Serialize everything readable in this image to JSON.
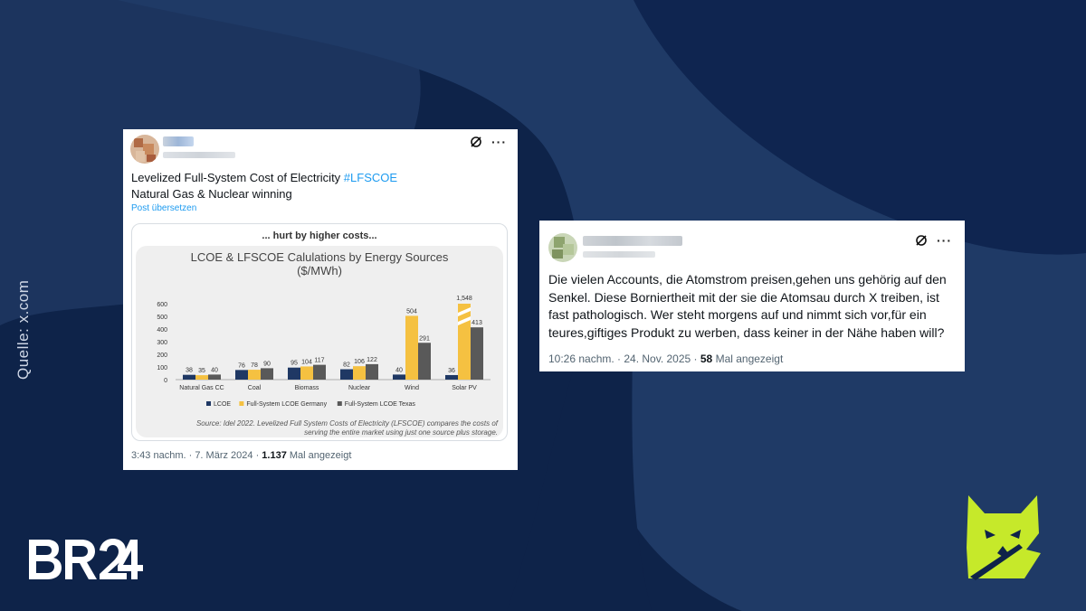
{
  "source_label": "Quelle: x.com",
  "brand_logo_text": "BR24",
  "icons": {
    "grok": "grok-slash-icon",
    "more": "more-dots-icon",
    "fox": "fox-logo"
  },
  "colors": {
    "background": "#0e2349",
    "hashtag": "#1d9bf0",
    "fox": "#c6e92a",
    "bar_lcoe": "#1f3864",
    "bar_germany": "#f5c141",
    "bar_texas": "#595959"
  },
  "tweet1": {
    "text_line1": "Levelized Full-System Cost of Electricity ",
    "hashtag": "#LFSCOE",
    "text_line2": "Natural Gas & Nuclear winning",
    "translate": "Post übersetzen",
    "media_header": "... hurt by higher costs...",
    "chart_title_line1": "LCOE & LFSCOE Calulations by Energy Sources",
    "chart_title_line2": "($/MWh)",
    "chart_source": "Source: Idel 2022. Levelized Full System Costs of Electricity (LFSCOE) compares the costs of serving the entire market using just one source plus storage.",
    "time": "3:43 nachm. · 7. März 2024 · ",
    "views_count": "1.137",
    "views_label": " Mal angezeigt"
  },
  "tweet2": {
    "text": "Die vielen Accounts, die Atomstrom preisen,gehen uns gehörig auf den Senkel. Diese Borniertheit mit der sie die Atomsau durch X treiben, ist fast  pathologisch. Wer steht morgens auf und nimmt sich vor,für ein teures,giftiges Produkt zu werben, dass keiner in der Nähe haben will?",
    "time": "10:26 nachm. · 24. Nov. 2025 · ",
    "views_count": "58",
    "views_label": " Mal angezeigt"
  },
  "chart_data": {
    "type": "bar",
    "title": "LCOE & LFSCOE Calulations by Energy Sources ($/MWh)",
    "categories": [
      "Natural Gas CC",
      "Coal",
      "Biomass",
      "Nuclear",
      "Wind",
      "Solar PV"
    ],
    "series": [
      {
        "name": "LCOE",
        "values": [
          38,
          76,
          95,
          82,
          40,
          36
        ]
      },
      {
        "name": "Full-System LCOE Germany",
        "values": [
          35,
          78,
          104,
          106,
          504,
          1548
        ]
      },
      {
        "name": "Full-System LCOE Texas",
        "values": [
          40,
          90,
          117,
          122,
          291,
          413
        ]
      }
    ],
    "yticks": [
      0,
      100,
      200,
      300,
      400,
      500,
      600
    ],
    "ylim": [
      0,
      600
    ],
    "legend_position": "bottom",
    "annotations": [
      "Solar PV Germany bar (1,548) truncated at the axis maximum"
    ],
    "labels": [
      [
        "38",
        "35",
        "40"
      ],
      [
        "76",
        "78",
        "90"
      ],
      [
        "95",
        "104",
        "117"
      ],
      [
        "82",
        "106",
        "122"
      ],
      [
        "40",
        "504",
        "291"
      ],
      [
        "36",
        "1,548",
        "413"
      ]
    ]
  }
}
